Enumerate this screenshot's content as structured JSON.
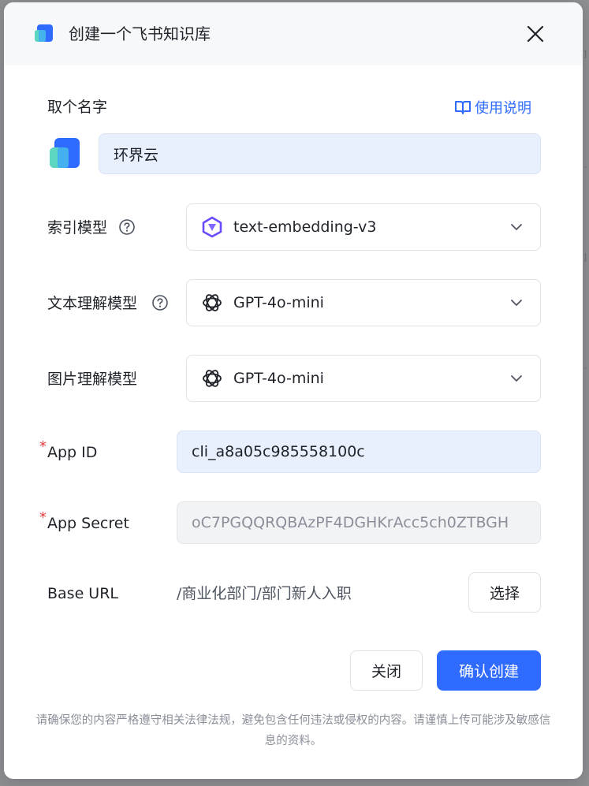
{
  "dialog": {
    "title": "创建一个飞书知识库",
    "close_icon": "close-icon"
  },
  "name_section": {
    "label": "取个名字",
    "usage_link": "使用说明",
    "name_value": "环界云"
  },
  "index_model": {
    "label": "索引模型",
    "value": "text-embedding-v3"
  },
  "text_model": {
    "label": "文本理解模型",
    "value": "GPT-4o-mini"
  },
  "image_model": {
    "label": "图片理解模型",
    "value": "GPT-4o-mini"
  },
  "app_id": {
    "required_mark": "*",
    "label": "App ID",
    "value": "cli_a8a05c985558100c"
  },
  "app_secret": {
    "required_mark": "*",
    "label": "App Secret",
    "placeholder": "oC7PGQQRQBAzPF4DGHKrAcc5ch0ZTBGH"
  },
  "base_url": {
    "label": "Base URL",
    "path": "/商业化部门/部门新人入职",
    "select_button": "选择"
  },
  "footer": {
    "close_button": "关闭",
    "confirm_button": "确认创建",
    "notice": "请确保您的内容严格遵守相关法律法规，避免包含任何违法或侵权的内容。请谨慎上传可能涉及敏感信息的资料。"
  },
  "colors": {
    "primary": "#2f6bff",
    "input_bg": "#e9f0fd",
    "required": "#e23b3b"
  }
}
